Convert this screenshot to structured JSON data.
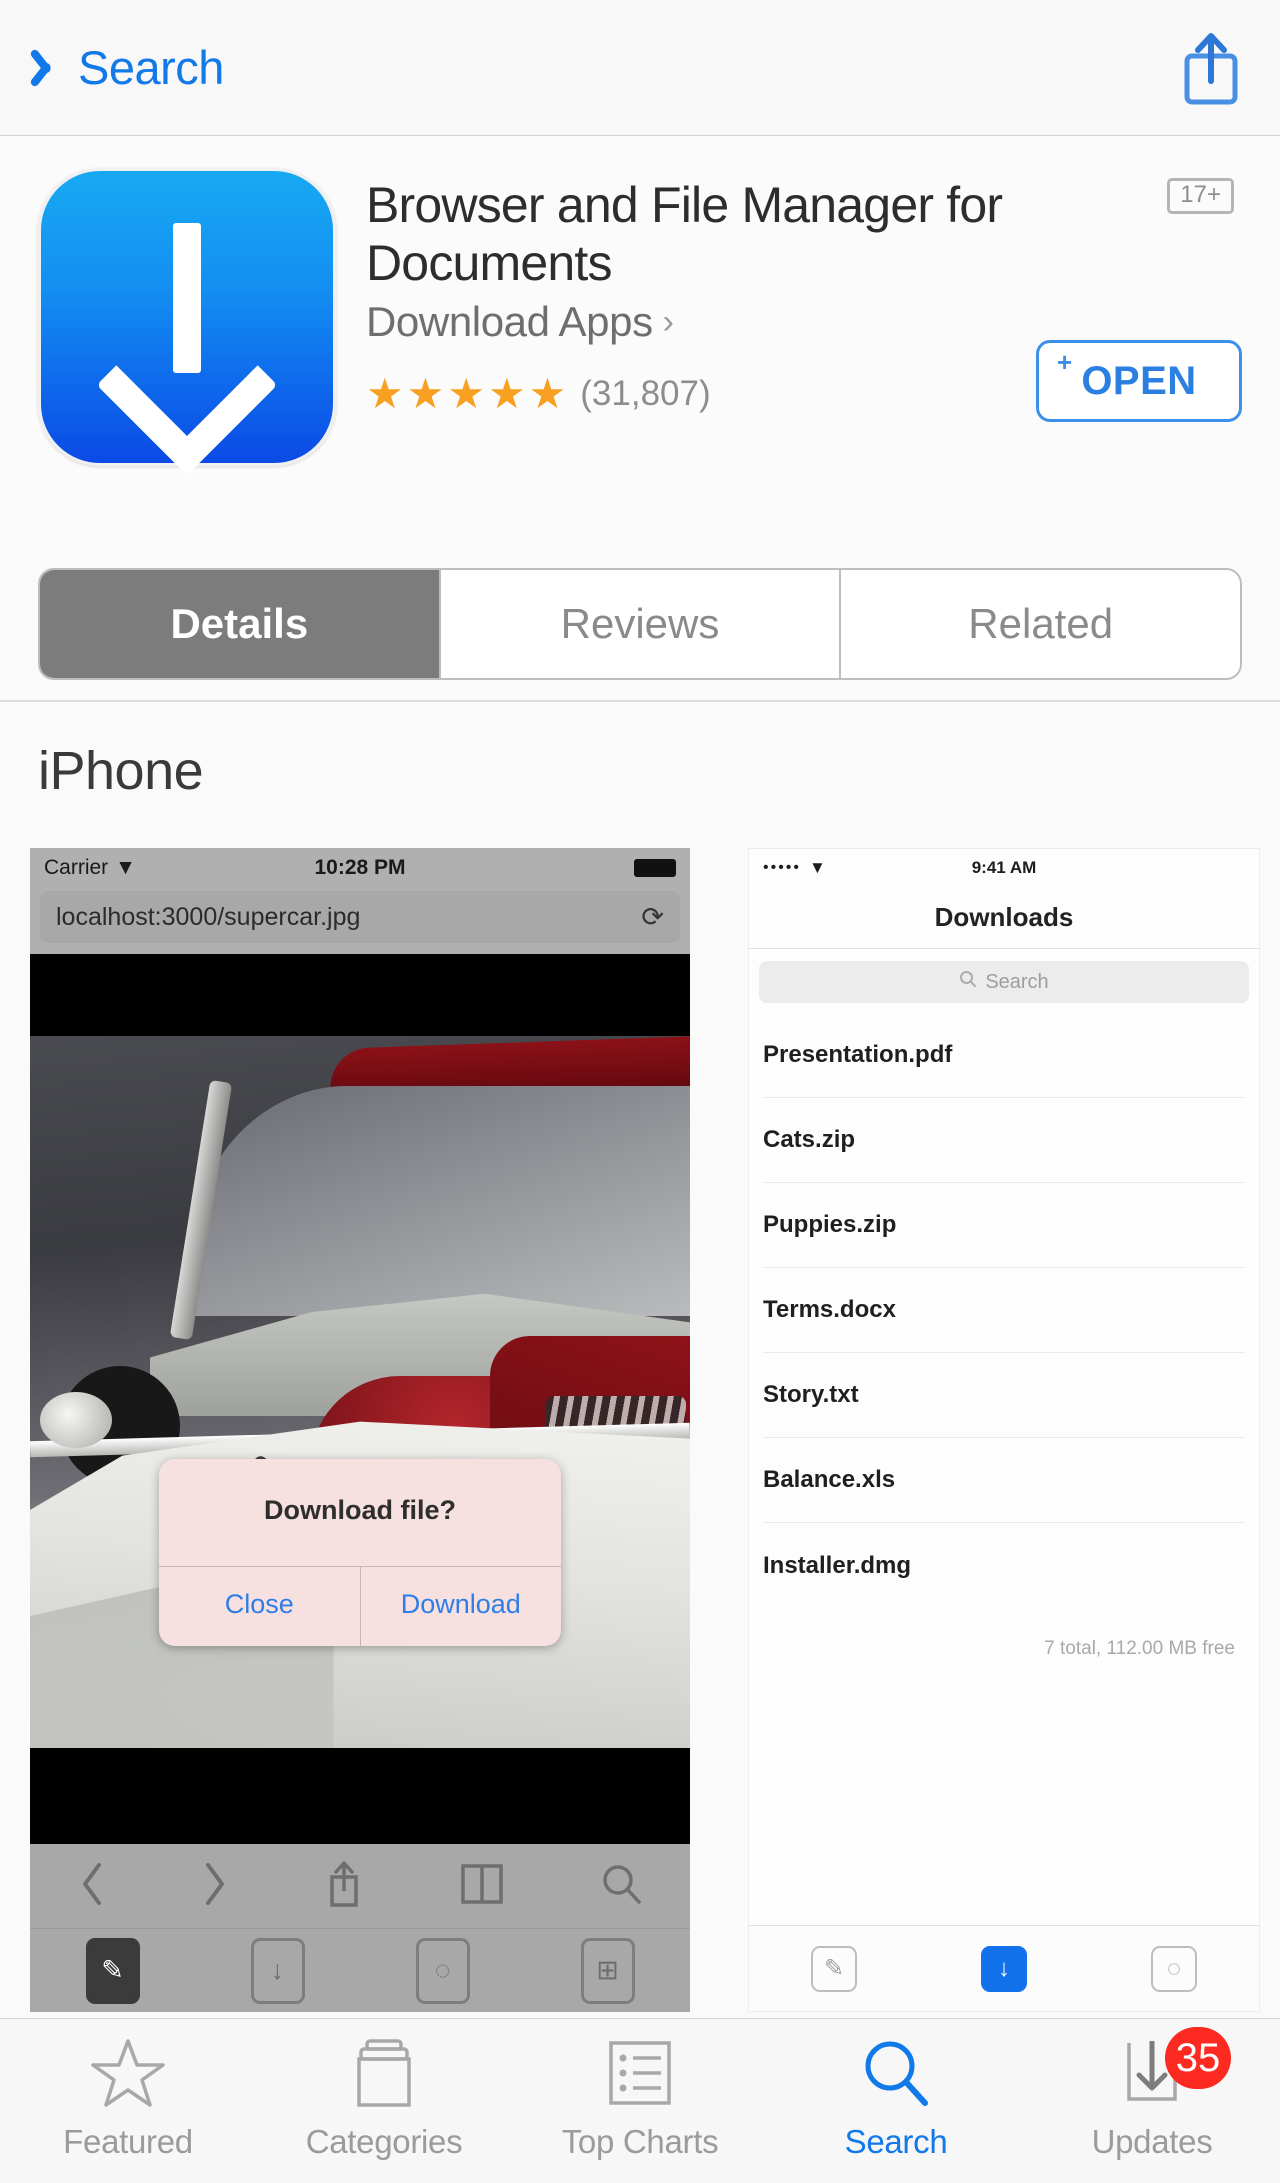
{
  "navbar": {
    "back_label": "Search",
    "back_icon": "chevron-left-icon",
    "share_icon": "share-icon"
  },
  "app": {
    "icon_name": "download-arrow-app-icon",
    "title": "Browser and File Manager for Documents",
    "developer": "Download Apps",
    "developer_chevron": "›",
    "age_rating": "17+",
    "stars": "★★★★★",
    "rating_count": "(31,807)",
    "open_label": "OPEN",
    "open_plus": "+",
    "accent_blue": "#1279e8",
    "star_orange": "#f7a021"
  },
  "segments": [
    {
      "label": "Details",
      "active": true
    },
    {
      "label": "Reviews",
      "active": false
    },
    {
      "label": "Related",
      "active": false
    }
  ],
  "section": {
    "title": "iPhone"
  },
  "shot_browser": {
    "status": {
      "carrier": "Carrier",
      "time": "10:28 PM",
      "wifi_icon": "wifi-icon",
      "battery_icon": "battery-icon"
    },
    "url": "localhost:3000/supercar.jpg",
    "reload_icon": "reload-icon",
    "alert": {
      "title": "Download file?",
      "close_label": "Close",
      "download_label": "Download"
    },
    "toolbar_icons": [
      "back-icon",
      "forward-icon",
      "share-icon",
      "bookmarks-icon",
      "search-icon"
    ],
    "tab_icons": [
      "compass-icon",
      "download-icon",
      "document-icon",
      "grid-icon"
    ]
  },
  "shot_downloads": {
    "status": {
      "signal": "•••••",
      "wifi_icon": "wifi-icon",
      "time": "9:41 AM"
    },
    "nav_title": "Downloads",
    "search_placeholder": "Search",
    "search_icon": "search-icon",
    "files": [
      "Presentation.pdf",
      "Cats.zip",
      "Puppies.zip",
      "Terms.docx",
      "Story.txt",
      "Balance.xls",
      "Installer.dmg"
    ],
    "footer": "7 total, 112.00 MB free",
    "tab_icons": [
      "compass-icon",
      "download-icon",
      "document-icon"
    ]
  },
  "tabbar": {
    "items": [
      {
        "label": "Featured",
        "icon": "star-icon",
        "active": false
      },
      {
        "label": "Categories",
        "icon": "folder-icon",
        "active": false
      },
      {
        "label": "Top Charts",
        "icon": "list-icon",
        "active": false
      },
      {
        "label": "Search",
        "icon": "search-icon",
        "active": true
      },
      {
        "label": "Updates",
        "icon": "download-icon",
        "active": false
      }
    ],
    "updates_badge": "35",
    "badge_color": "#fc2a21"
  }
}
